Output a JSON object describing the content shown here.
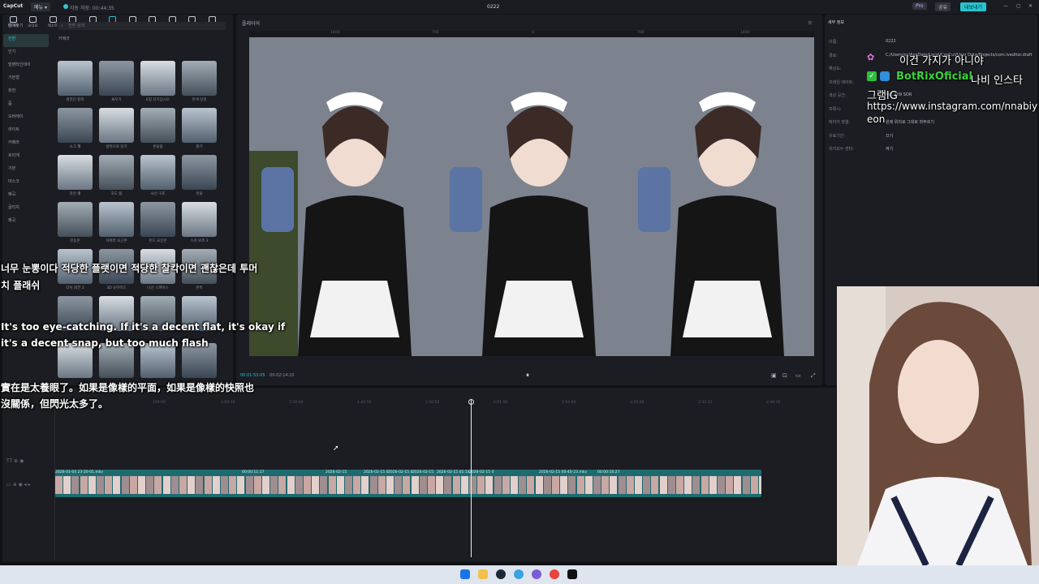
{
  "topbar": {
    "app_name": "CapCut",
    "menu_label": "메뉴 ▾",
    "autosave": "자동 저장: 00:44:35",
    "title": "0222",
    "pro_label": "Pro",
    "share_label": "공유",
    "export_label": "내보내기",
    "window_controls": [
      "—",
      "▢",
      "✕"
    ]
  },
  "toolbar": {
    "items": [
      {
        "label": "미디어",
        "active": false
      },
      {
        "label": "오디오",
        "active": false
      },
      {
        "label": "텍스트",
        "active": false
      },
      {
        "label": "스티커",
        "active": false
      },
      {
        "label": "편집효과",
        "active": false
      },
      {
        "label": "전환",
        "active": true
      },
      {
        "label": "캡션",
        "active": false
      },
      {
        "label": "필터",
        "active": false
      },
      {
        "label": "조정",
        "active": false
      },
      {
        "label": "템플릿",
        "active": false
      },
      {
        "label": "AI 아바타",
        "active": false
      }
    ]
  },
  "categories": {
    "items": [
      {
        "label": "즐겨찾기",
        "active": false
      },
      {
        "label": "전환",
        "active": true
      },
      {
        "label": "인기",
        "active": false
      },
      {
        "label": "발렌타인데이",
        "active": false
      },
      {
        "label": "기본형",
        "active": false
      },
      {
        "label": "회전",
        "active": false
      },
      {
        "label": "줌",
        "active": false
      },
      {
        "label": "오버레이",
        "active": false
      },
      {
        "label": "라이트",
        "active": false
      },
      {
        "label": "카메라",
        "active": false
      },
      {
        "label": "흐리게",
        "active": false
      },
      {
        "label": "기본",
        "active": false
      },
      {
        "label": "마스크",
        "active": false
      },
      {
        "label": "왜곡",
        "active": false
      },
      {
        "label": "글리치",
        "active": false
      },
      {
        "label": "왜곡",
        "active": false
      }
    ]
  },
  "search": {
    "placeholder": "전환 검색"
  },
  "grid": {
    "header": "카메라",
    "tiles": [
      "원리인 창의",
      "새우기",
      "E형 당기십시오",
      "흔게 당김",
      "소그 쾌",
      "앞뒤으로 당기",
      "흔들림",
      "풍기",
      "라진 쾌",
      "호도 쯤",
      "샤선 구조",
      "흔들",
      "진동흔",
      "하위라 요근흔",
      "흔드 요인흔",
      "스치 보조 3",
      "다뉘 회전 2",
      "3D 슈어이드",
      "나선 스파이스",
      "흔특",
      "",
      "",
      "",
      "",
      "",
      "",
      "",
      ""
    ]
  },
  "player": {
    "label": "플레이어",
    "ruler_ticks": [
      "1400",
      "700",
      "0",
      "700",
      "1400"
    ],
    "timecode_current": "00:01:53:05",
    "timecode_total": "00:02:14:10",
    "play_icon": "pause-icon"
  },
  "rightpanel": {
    "tabs": [
      "세부 정보"
    ],
    "props": [
      {
        "key": "이름:",
        "value": "0222"
      },
      {
        "key": "경로:",
        "value": "C:/Users/oc/AppData/Local/CapCut/User Data/Projects/com.lveditor.draft/0222"
      },
      {
        "key": "해상도:",
        "value": ""
      },
      {
        "key": "프레임 레이트:",
        "value": ""
      },
      {
        "key": "색상 공간:",
        "value": "Rec.709 SDR"
      },
      {
        "key": "프록시:",
        "value": ""
      },
      {
        "key": "레이어 정렬:",
        "value": "원래 위치로 그대로 마무르기"
      },
      {
        "key": "유효기간:",
        "value": "끄기"
      },
      {
        "key": "유지보수 센터:",
        "value": "켜기"
      }
    ]
  },
  "timeline": {
    "ruler_ticks": [
      "100:00",
      "1:00:30",
      "1:30:48",
      "1:40:52",
      "1:50:56",
      "2:01:00",
      "2:10:04",
      "2:20:08",
      "2:30:12",
      "2:40:16"
    ],
    "clip_labels": [
      "2026-01-04 23-20-01.mkv",
      "00:00:11:17",
      "2026-02-15",
      "2026-02-15 0",
      "2026-02-15 0",
      "2026-02-15",
      "2026-02-15 01:14",
      "2026-02-15 0",
      "2026-02-15 00-40-23.mkv",
      "00:00:16:27"
    ]
  },
  "subtitles": {
    "korean_line1": "너무 눈뽕이다 적당한 플랫이면 적당한 찰칵이면 괜찮은데 투머",
    "korean_line2": "치 플래쉬",
    "english_line1": "It's too eye-catching. If it's a decent flat, it's okay if",
    "english_line2": "it's a decent snap, but too much flash",
    "chinese_line1": "實在是太養眼了。如果是像樣的平面，如果是像樣的快照也",
    "chinese_line2": "沒關係，但閃光太多了。"
  },
  "chat": {
    "line1": "이건 가지가 아니야",
    "user": "BotRixOficial",
    "msg_part1": "나비 인스타",
    "msg_part2": "그램IG",
    "url_line1": "https://www.instagram.com/nnabiy",
    "url_line2": "eon"
  },
  "colors": {
    "accent": "#27c4cf",
    "chat_user": "#3ad33a",
    "clip": "#1d6b6f"
  }
}
